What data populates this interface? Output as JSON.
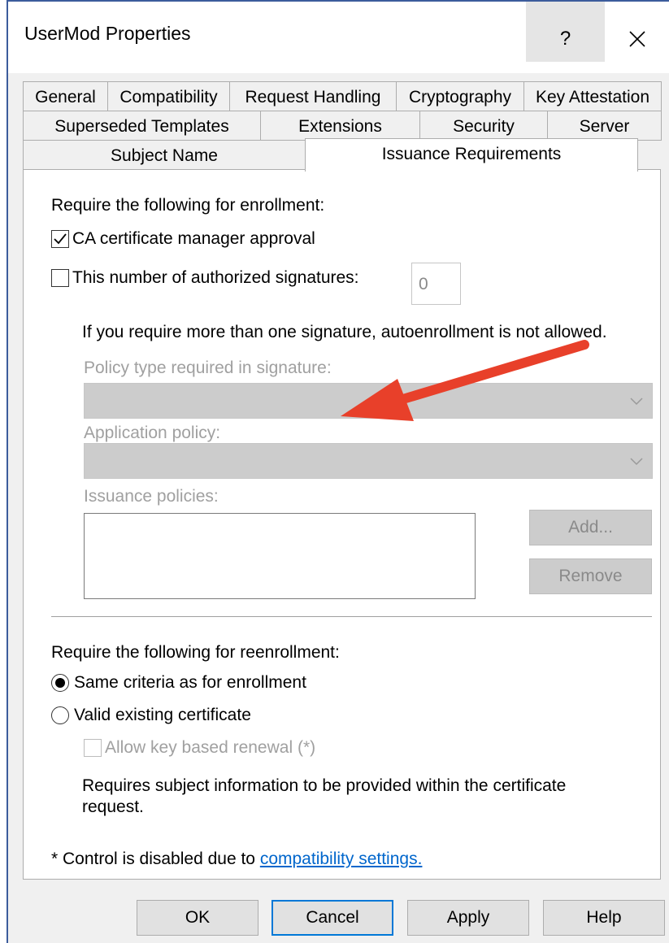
{
  "window": {
    "title": "UserMod Properties",
    "help_glyph": "?",
    "close_icon": "close-icon"
  },
  "tabs": {
    "row1": [
      "General",
      "Compatibility",
      "Request Handling",
      "Cryptography",
      "Key Attestation"
    ],
    "row2": [
      "Superseded Templates",
      "Extensions",
      "Security",
      "Server"
    ],
    "row3": [
      "Subject Name",
      "Issuance Requirements"
    ],
    "active": "Issuance Requirements"
  },
  "enrollment": {
    "heading": "Require the following for enrollment:",
    "ca_approval_label": "CA certificate manager approval",
    "ca_approval_checked": true,
    "signatures_label": "This number of authorized signatures:",
    "signatures_checked": false,
    "signatures_value": "0",
    "signature_note": "If you require more than one signature, autoenrollment is not allowed.",
    "policy_type_label": "Policy type required in signature:",
    "application_policy_label": "Application policy:",
    "issuance_policies_label": "Issuance policies:",
    "add_label": "Add...",
    "remove_label": "Remove"
  },
  "reenrollment": {
    "heading": "Require the following for reenrollment:",
    "same_criteria_label": "Same criteria as for enrollment",
    "valid_cert_label": "Valid existing certificate",
    "selected": "Same criteria as for enrollment",
    "allow_key_renewal_label": "Allow key based renewal (*)",
    "allow_key_renewal_checked": false,
    "requires_note_line1": "Requires subject information to be provided within the certificate",
    "requires_note_line2": "request."
  },
  "footnote": {
    "prefix": "* Control is disabled due to ",
    "link": "compatibility settings."
  },
  "buttons": {
    "ok": "OK",
    "cancel": "Cancel",
    "apply": "Apply",
    "help": "Help"
  },
  "colors": {
    "annotation_arrow": "#e8402a",
    "window_border": "#3c5c9c",
    "link": "#0066cc",
    "focus_border": "#0078d7"
  }
}
